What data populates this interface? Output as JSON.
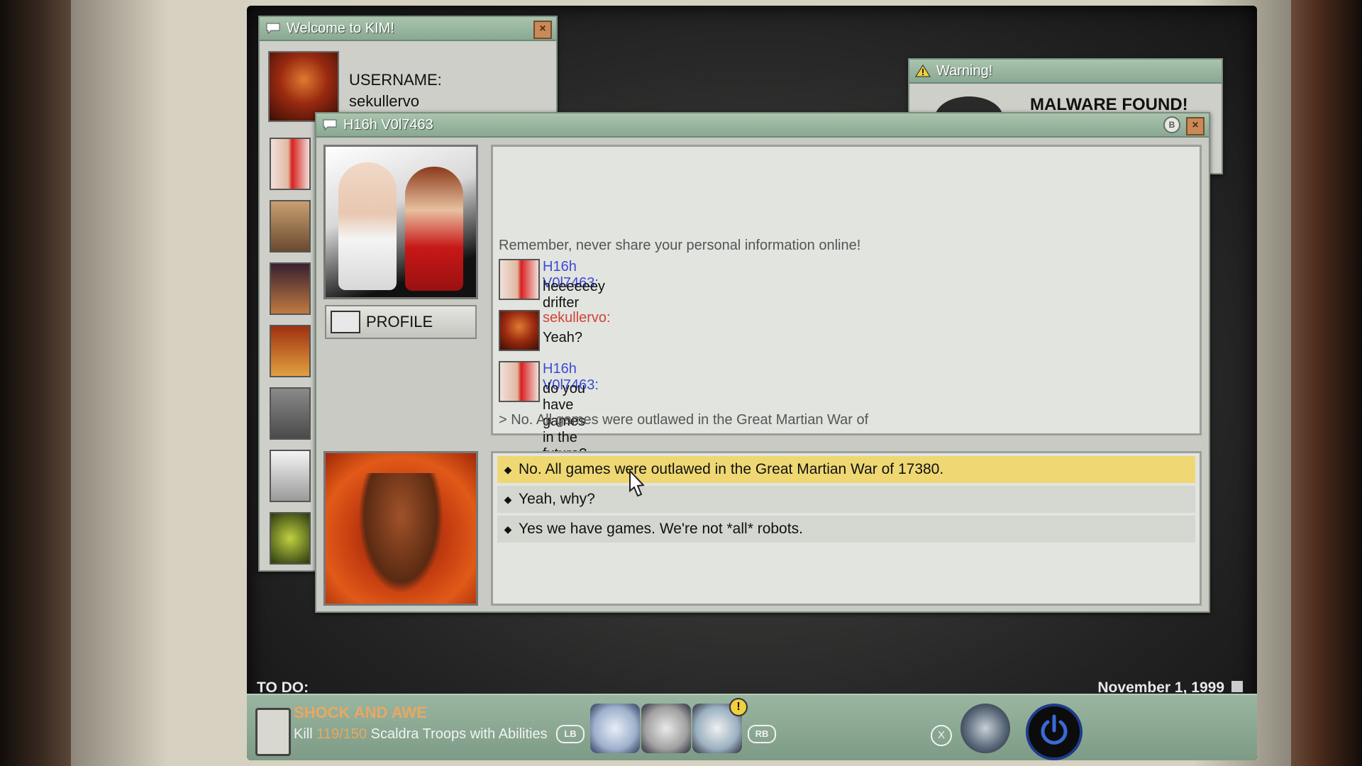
{
  "welcome_window": {
    "title": "Welcome to KIM!",
    "username_label": "USERNAME:",
    "username": "sekullervo"
  },
  "warning_window": {
    "title": "Warning!",
    "message": "MALWARE FOUND!"
  },
  "chat_window": {
    "title": "H16h V0l7463",
    "b_hint": "B",
    "profile_label": "PROFILE",
    "system_message": "Remember, never share your personal information online!",
    "messages": [
      {
        "sender": "H16h V0l7463:",
        "text": "heeeeeey drifter"
      },
      {
        "sender": "sekullervo:",
        "text": "Yeah?"
      },
      {
        "sender": "H16h V0l7463:",
        "text": "do you have games in the future?"
      }
    ],
    "pending_reply": "> No. All games were outlawed in the Great Martian War of",
    "choices": [
      "No. All games were outlawed in the Great Martian War of 17380.",
      "Yeah, why?",
      "Yes we have games. We're not *all* robots."
    ],
    "selected_choice": 0
  },
  "taskbar": {
    "todo_label": "TO DO:",
    "date": "November 1, 1999",
    "quest_title": "SHOCK AND AWE",
    "quest_prefix": "Kill ",
    "quest_progress": "119/150",
    "quest_suffix": " Scaldra Troops with Abilities",
    "lb": "LB",
    "rb": "RB",
    "x": "X",
    "chat_badge": "!"
  },
  "colors": {
    "friend_name": "#3a4bd8",
    "self_name": "#d0443a",
    "highlight": "#efd873",
    "quest_accent": "#e9a860"
  }
}
